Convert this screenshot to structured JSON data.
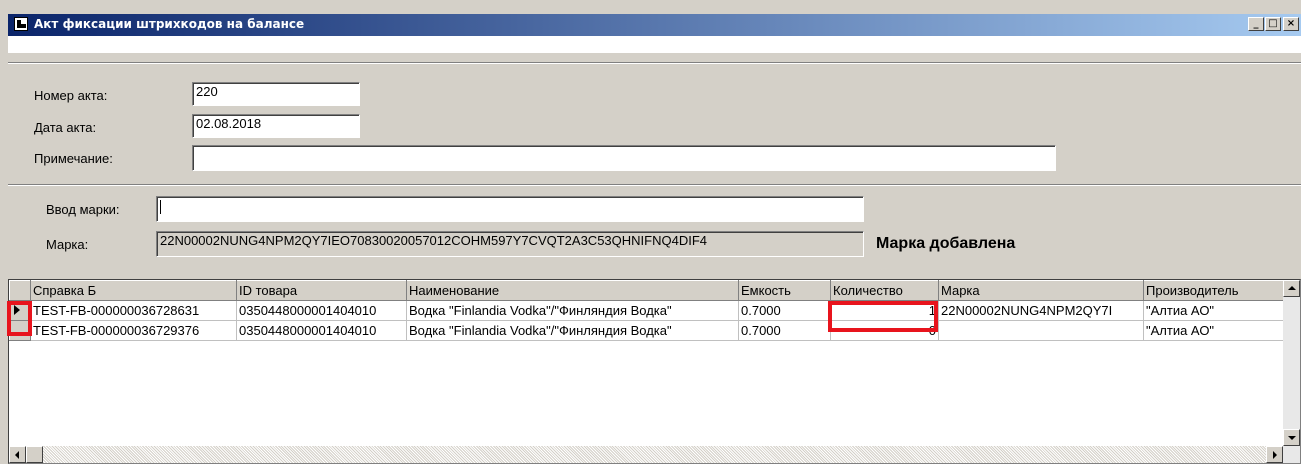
{
  "window": {
    "title": "Акт фиксации штрихкодов на балансе",
    "minimize_label": "_",
    "restore_label": "□",
    "close_label": "×"
  },
  "form": {
    "act_number_label": "Номер акта:",
    "act_number_value": "220",
    "act_date_label": "Дата акта:",
    "act_date_value": "02.08.2018",
    "note_label": "Примечание:",
    "note_value": "",
    "mark_input_label": "Ввод марки:",
    "mark_input_value": "",
    "mark_label": "Марка:",
    "mark_value": "22N00002NUNG4NPM2QY7IEO70830020057012COHM597Y7CVQT2A3C53QHNIFNQ4DIF4",
    "status_message": "Марка добавлена"
  },
  "grid": {
    "columns": [
      "Справка Б",
      "ID товара",
      "Наименование",
      "Емкость",
      "Количество",
      "Марка",
      "Производитель"
    ],
    "rows": [
      {
        "current": true,
        "spravka": "TEST-FB-000000036728631",
        "id": "0350448000001404010",
        "name": "Водка \"Finlandia Vodka\"/\"Финляндия Водка\"",
        "capacity": "0.7000",
        "quantity": "1",
        "mark": "22N00002NUNG4NPM2QY7I",
        "producer": "\"Алтиа АО\""
      },
      {
        "current": false,
        "spravka": "TEST-FB-000000036729376",
        "id": "0350448000001404010",
        "name": "Водка \"Finlandia Vodka\"/\"Финляндия Водка\"",
        "capacity": "0.7000",
        "quantity": "0",
        "mark": "",
        "producer": "\"Алтиа АО\""
      }
    ]
  },
  "icons": {
    "app": "form-app-icon",
    "row_indicator": "current-row-arrow-icon"
  },
  "colors": {
    "titlebar_start": "#0a246a",
    "titlebar_end": "#a6caf0",
    "window_bg": "#d4d0c8",
    "highlight": "#e8141d"
  }
}
